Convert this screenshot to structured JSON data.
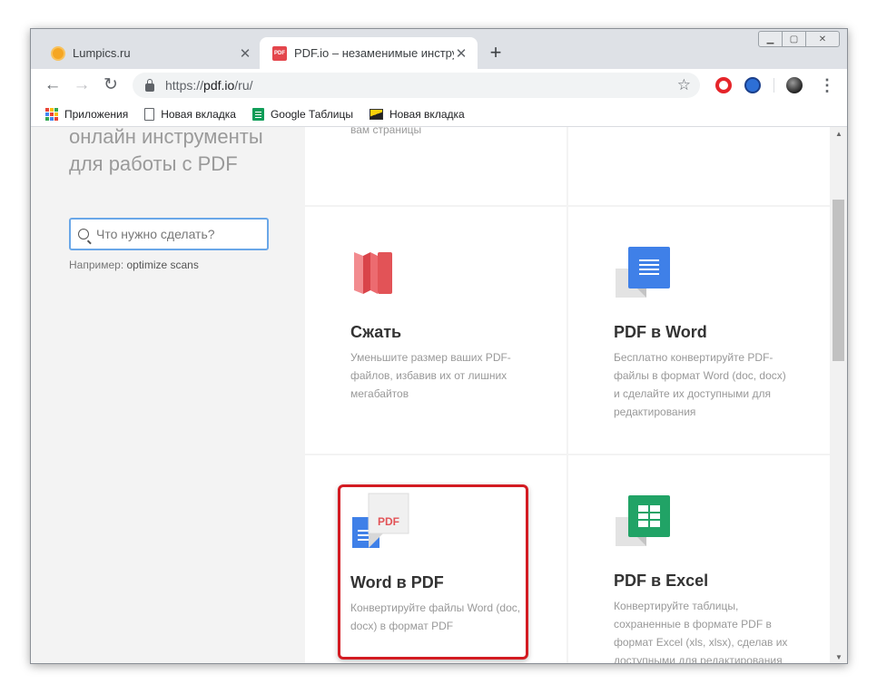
{
  "tabs": [
    {
      "title": "Lumpics.ru",
      "close": "✕"
    },
    {
      "title": "PDF.io – незаменимые инструме",
      "close": "✕",
      "favicon_text": "PDF"
    }
  ],
  "newtab": "+",
  "omnibox": {
    "scheme": "https://",
    "host": "pdf.io",
    "path": "/ru/"
  },
  "bookmarks": [
    {
      "label": "Приложения"
    },
    {
      "label": "Новая вкладка"
    },
    {
      "label": "Google Таблицы"
    },
    {
      "label": "Новая вкладка"
    }
  ],
  "sidebar": {
    "heading_line1": "онлайн инструменты",
    "heading_line2": "для работы с PDF",
    "search_placeholder": "Что нужно сделать?",
    "example_prefix": "Например: ",
    "example_value": "optimize scans"
  },
  "partial_card_desc": "вам страницы",
  "cards": [
    {
      "name": "Сжать",
      "desc": "Уменьшите размер ваших PDF-файлов, избавив их от лишних мегабайтов",
      "icon": "compress-icon"
    },
    {
      "name": "PDF в Word",
      "desc": "Бесплатно конвертируйте PDF-файлы в формат Word (doc, docx) и сделайте их доступными для редактирования",
      "icon": "pdf-to-word-icon"
    },
    {
      "name": "Word в PDF",
      "desc": "Конвертируйте файлы Word (doc, docx) в формат PDF",
      "icon": "word-to-pdf-icon",
      "icon_text": "PDF"
    },
    {
      "name": "PDF в Excel",
      "desc": "Конвертируйте таблицы, сохраненные в формате PDF в формат Excel (xls, xlsx), сделав их доступными для редактирования",
      "icon": "pdf-to-excel-icon"
    }
  ],
  "colors": {
    "accent": "#4285f4",
    "highlight": "#d31b22",
    "compress": "#e25357",
    "excel": "#21a366"
  }
}
